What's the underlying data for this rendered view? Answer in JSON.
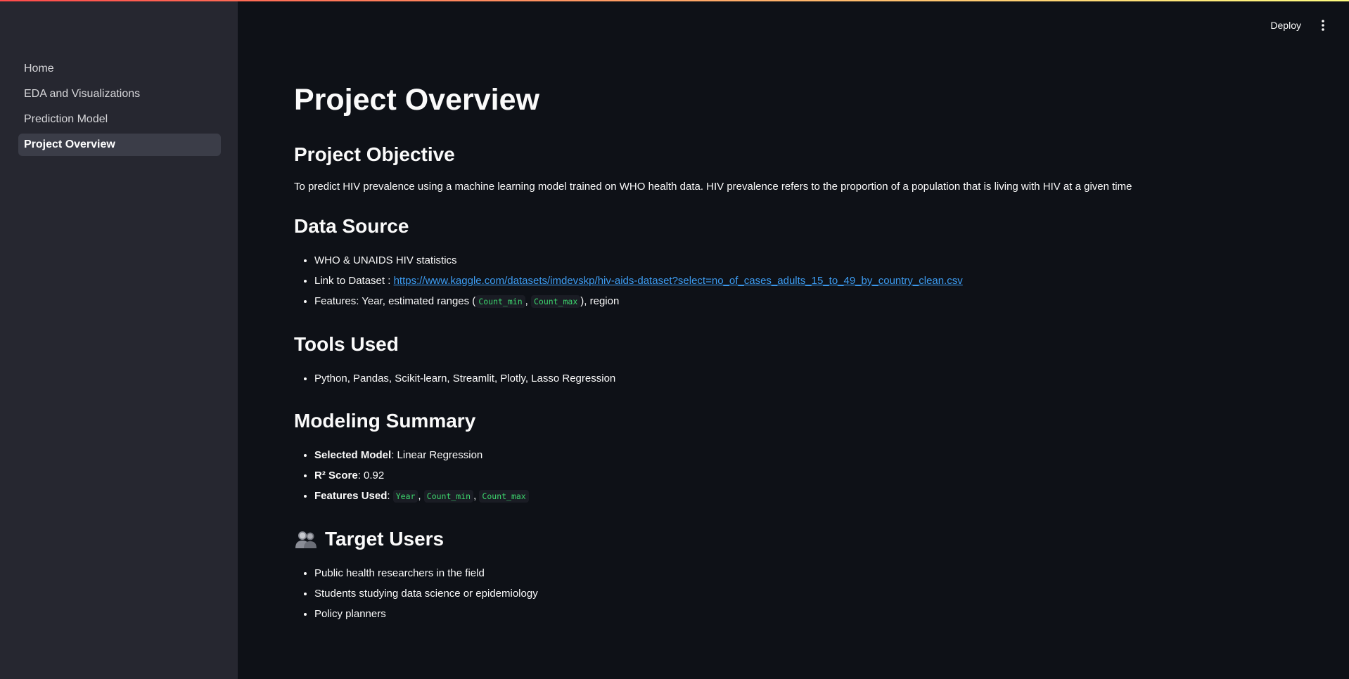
{
  "header": {
    "deploy_label": "Deploy"
  },
  "sidebar": {
    "items": [
      {
        "label": "Home"
      },
      {
        "label": "EDA and Visualizations"
      },
      {
        "label": "Prediction Model"
      },
      {
        "label": "Project Overview",
        "active": true
      }
    ]
  },
  "main": {
    "title": "Project Overview",
    "objective": {
      "heading": "Project Objective",
      "text": "To predict HIV prevalence using a machine learning model trained on WHO health data. HIV prevalence refers to the proportion of a population that is living with HIV at a given time"
    },
    "data_source": {
      "heading": "Data Source",
      "item1": "WHO & UNAIDS HIV statistics",
      "link_prefix": "Link to Dataset : ",
      "link_url": "https://www.kaggle.com/datasets/imdevskp/hiv-aids-dataset?select=no_of_cases_adults_15_to_49_by_country_clean.csv",
      "features_prefix": "Features: Year, estimated ranges (",
      "code1": "Count_min",
      "sep": ",",
      "code2": "Count_max",
      "features_suffix": "), region"
    },
    "tools": {
      "heading": "Tools Used",
      "item1": "Python, Pandas, Scikit-learn, Streamlit, Plotly, Lasso Regression"
    },
    "modeling": {
      "heading": "Modeling Summary",
      "selected_label": "Selected Model",
      "selected_value": ": Linear Regression",
      "r2_label": "R² Score",
      "r2_value": ": 0.92",
      "features_label": "Features Used",
      "features_colon": ": ",
      "f1": "Year",
      "f2": "Count_min",
      "f3": "Count_max",
      "sep": ","
    },
    "target_users": {
      "heading": "Target Users",
      "icon": "people-icon",
      "items": [
        "Public health researchers in the field",
        "Students studying data science or epidemiology",
        "Policy planners"
      ]
    }
  }
}
